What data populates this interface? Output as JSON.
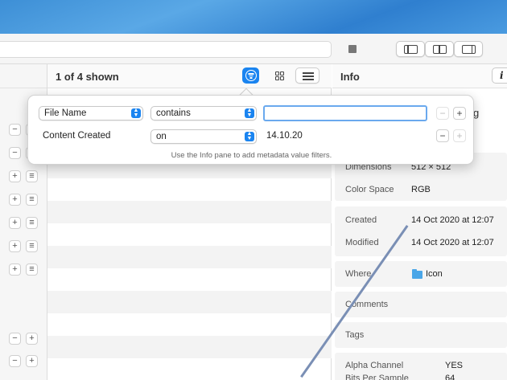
{
  "list_header": {
    "shown": "1 of 4 shown"
  },
  "info_pane": {
    "title": "Info",
    "info_button": "i",
    "partial_text": "g",
    "rows": [
      {
        "label": "Dimensions",
        "value": "512 × 512"
      },
      {
        "label": "Color Space",
        "value": "RGB"
      },
      {
        "label": "Created",
        "value": "14 Oct 2020 at 12:07"
      },
      {
        "label": "Modified",
        "value": "14 Oct 2020 at 12:07"
      },
      {
        "label": "Where",
        "value": "Icon"
      },
      {
        "label": "Comments",
        "value": ""
      },
      {
        "label": "Tags",
        "value": ""
      },
      {
        "label": "Alpha Channel",
        "value": "YES"
      },
      {
        "label": "Bits Per Sample",
        "value": "64"
      }
    ]
  },
  "filter_popover": {
    "rule1": {
      "attribute": "File Name",
      "operator": "contains",
      "value": ""
    },
    "rule2": {
      "attribute": "Content Created",
      "operator": "on",
      "value": "14.10.20"
    },
    "hint": "Use the Info pane to add metadata value filters.",
    "minus": "−",
    "plus": "+"
  },
  "left_pane": {
    "plus": "+",
    "minus": "−",
    "menu": "≡"
  },
  "colors": {
    "accent": "#1a84f0",
    "focus_ring": "#6aa9ee"
  }
}
